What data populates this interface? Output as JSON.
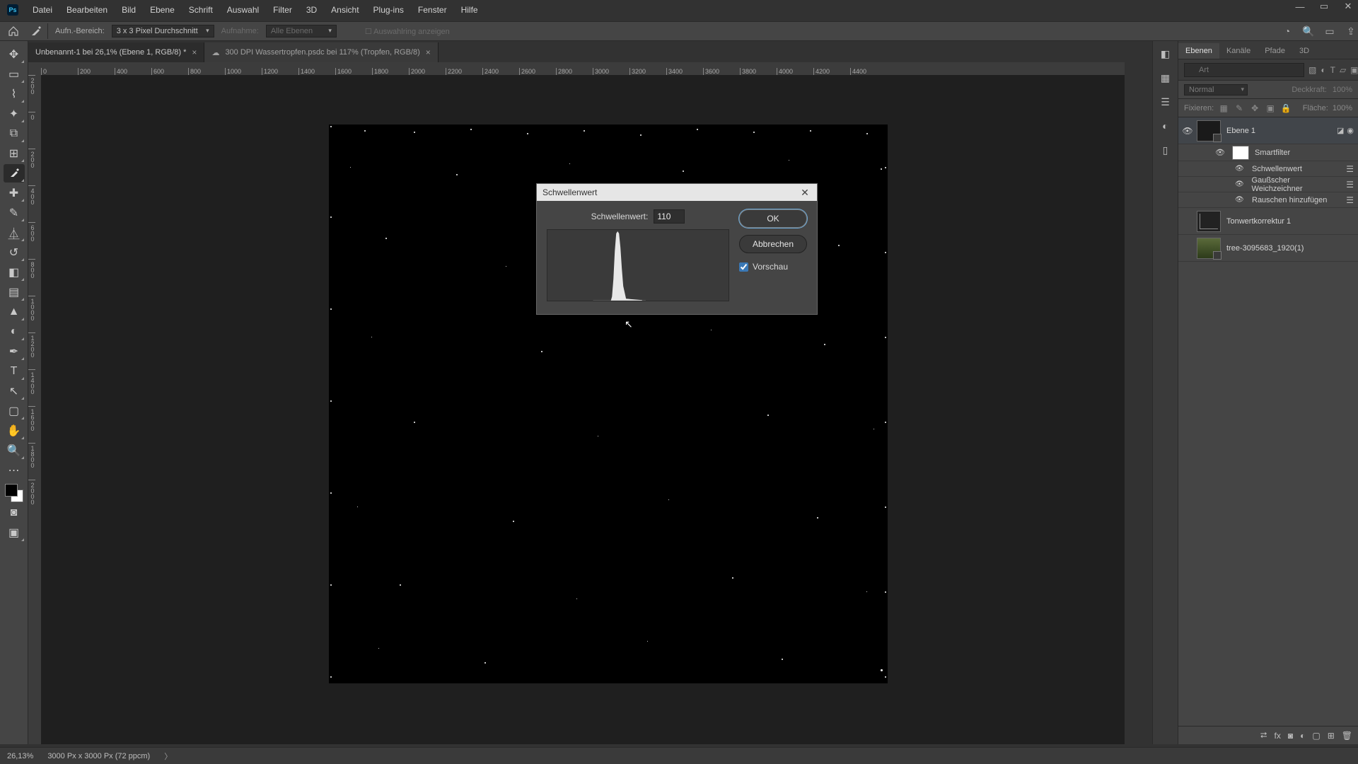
{
  "window_controls": {
    "min": "—",
    "max": "▭",
    "close": "✕"
  },
  "menu": {
    "app_icon": "Ps",
    "items": [
      "Datei",
      "Bearbeiten",
      "Bild",
      "Ebene",
      "Schrift",
      "Auswahl",
      "Filter",
      "3D",
      "Ansicht",
      "Plug-ins",
      "Fenster",
      "Hilfe"
    ]
  },
  "options": {
    "sample_label": "Aufn.-Bereich:",
    "sample_value": "3 x 3 Pixel Durchschnitt",
    "sample2_label": "Aufnahme:",
    "sample2_value": "Alle Ebenen",
    "show_ring": "Auswahlring anzeigen"
  },
  "tabs": [
    {
      "label": "Unbenannt-1 bei 26,1% (Ebene 1, RGB/8) *"
    },
    {
      "label": "300 DPI Wassertropfen.psdc bei 117% (Tropfen, RGB/8)",
      "cloud": true
    }
  ],
  "ruler_h": [
    "0",
    "200",
    "400",
    "600",
    "800",
    "1000",
    "1200",
    "1400",
    "1600",
    "1800",
    "2000",
    "2200",
    "2400",
    "2600",
    "2800",
    "3000",
    "3200",
    "3400",
    "3600",
    "3800",
    "4000",
    "4200",
    "4400"
  ],
  "ruler_v": [
    "200",
    "0",
    "200",
    "400",
    "600",
    "800",
    "1000",
    "1200",
    "1400",
    "1600",
    "1800",
    "2000"
  ],
  "dialog": {
    "title": "Schwellenwert",
    "field_label": "Schwellenwert:",
    "value": "110",
    "ok": "OK",
    "cancel": "Abbrechen",
    "preview": "Vorschau"
  },
  "panels": {
    "tabs": [
      "Ebenen",
      "Kanäle",
      "Pfade",
      "3D"
    ],
    "search_placeholder": "Art",
    "blend_mode": "Normal",
    "opacity_label": "Deckkraft:",
    "opacity_value": "100%",
    "lock_label": "Fixieren:",
    "fill_label": "Fläche:",
    "fill_value": "100%",
    "layers": [
      {
        "name": "Ebene 1",
        "smart": true
      },
      {
        "name": "Tonwertkorrektur 1"
      },
      {
        "name": "tree-3095683_1920(1)"
      }
    ],
    "smartfilter_header": "Smartfilter",
    "filters": [
      "Schwellenwert",
      "Gaußscher Weichzeichner",
      "Rauschen hinzufügen"
    ]
  },
  "status": {
    "zoom": "26,13%",
    "doc_info": "3000 Px x 3000 Px (72 ppcm)"
  }
}
